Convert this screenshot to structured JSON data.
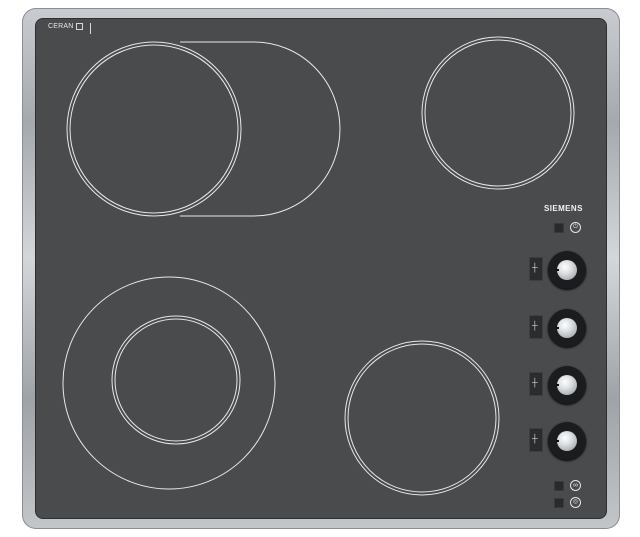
{
  "brand": {
    "maker": "SIEMENS",
    "surface": "CERAN"
  },
  "controls": {
    "indicator_led": "off",
    "knobs": [
      {
        "position": "rear-left"
      },
      {
        "position": "front-left"
      },
      {
        "position": "front-right"
      },
      {
        "position": "rear-right"
      }
    ]
  },
  "colors": {
    "glass": "#4a4b4c",
    "frame": "#b6babe",
    "ring": "#e8e8e8"
  },
  "icons": [
    "power-icon",
    "dual-zone-icon",
    "extended-zone-icon"
  ]
}
